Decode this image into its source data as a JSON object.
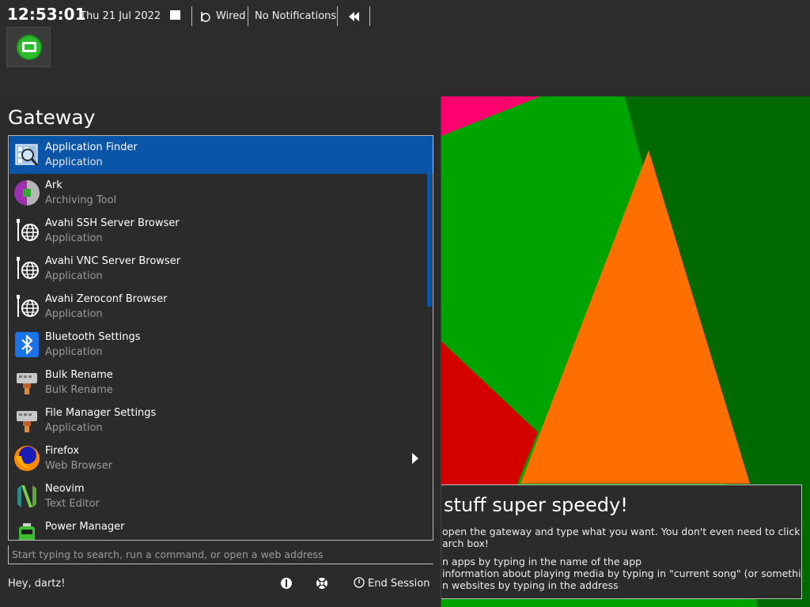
{
  "panel": {
    "clock": "12:53:01",
    "date": "Thu 21 Jul 2022",
    "network_label": "Wired",
    "notifications_label": "No Notifications"
  },
  "menu": {
    "title": "Gateway",
    "items": [
      {
        "name": "Application Finder",
        "category": "Application",
        "icon": "app-finder-icon",
        "selected": true
      },
      {
        "name": "Ark",
        "category": "Archiving Tool",
        "icon": "ark-icon"
      },
      {
        "name": "Avahi SSH Server Browser",
        "category": "Application",
        "icon": "globe-icon"
      },
      {
        "name": "Avahi VNC Server Browser",
        "category": "Application",
        "icon": "globe-icon"
      },
      {
        "name": "Avahi Zeroconf Browser",
        "category": "Application",
        "icon": "globe-icon"
      },
      {
        "name": "Bluetooth Settings",
        "category": "Application",
        "icon": "bluetooth-icon"
      },
      {
        "name": "Bulk Rename",
        "category": "Bulk Rename",
        "icon": "bulk-rename-icon"
      },
      {
        "name": "File Manager Settings",
        "category": "Application",
        "icon": "file-manager-settings-icon"
      },
      {
        "name": "Firefox",
        "category": "Web Browser",
        "icon": "firefox-icon",
        "has_submenu": true
      },
      {
        "name": "Neovim",
        "category": "Text Editor",
        "icon": "neovim-icon"
      },
      {
        "name": "Power Manager",
        "category": "",
        "icon": "battery-icon"
      }
    ],
    "search_placeholder": "Start typing to search, run a command, or open a web address",
    "greeting": "Hey, dartz!",
    "end_session_label": "End Session"
  },
  "card": {
    "title": "stuff super speedy!",
    "lines": [
      "open the gateway and type what you want. You don't even need to click on",
      "arch box!",
      "n apps by typing in the name of the app",
      "information about playing media by typing in \"current song\" (or something",
      "n websites by typing in the address"
    ]
  },
  "colors": {
    "selected": "#0b55a8",
    "wall_green": "#00a400",
    "wall_dark_green": "#006900",
    "wall_orange": "#ff6e00",
    "wall_red": "#d40000",
    "wall_pink": "#ff006e"
  }
}
